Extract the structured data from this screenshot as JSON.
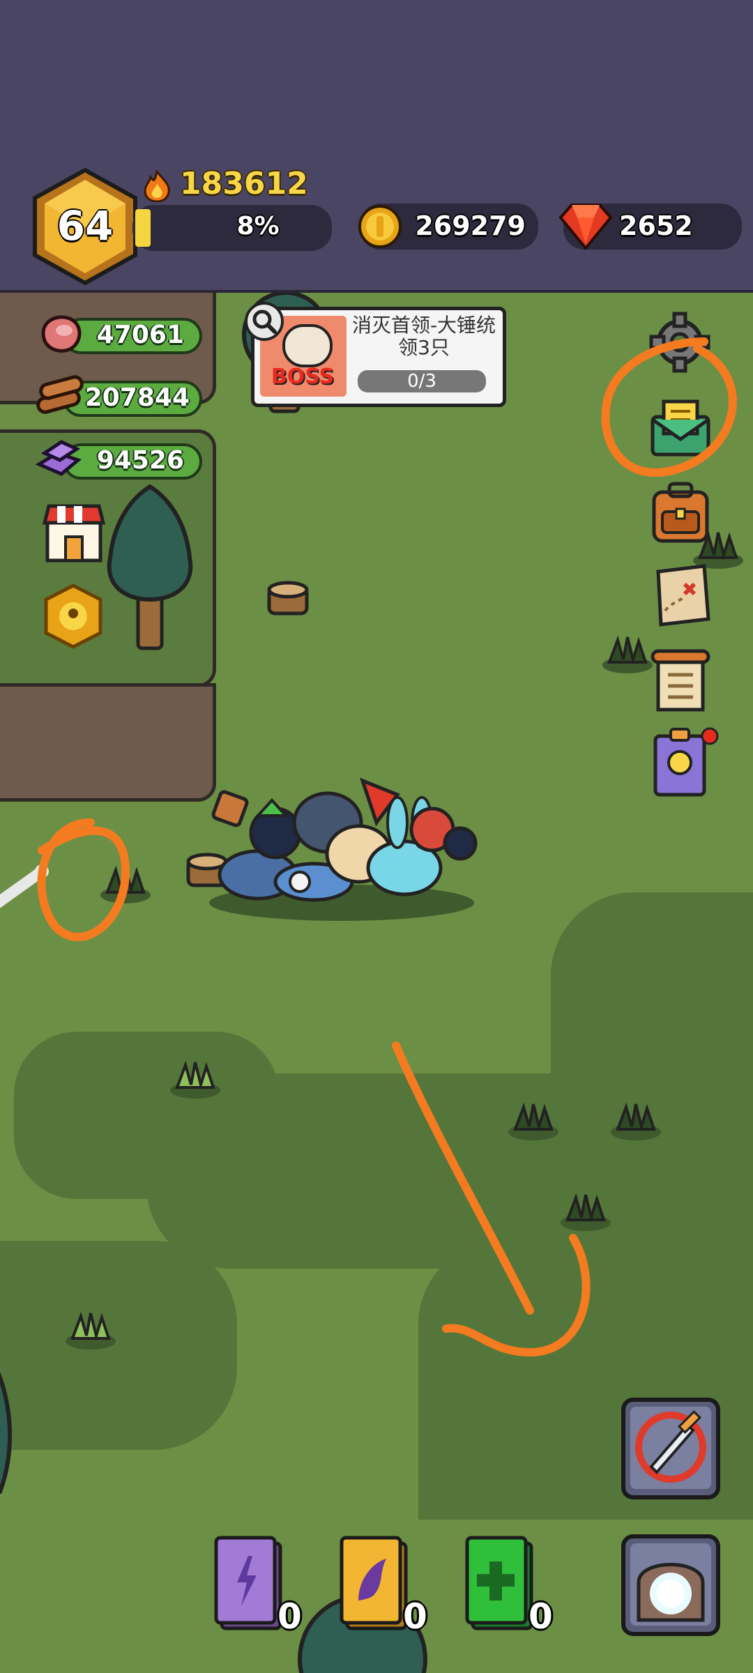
{
  "header": {
    "level": "64",
    "power": "183612",
    "exp_percent": "8%",
    "exp_progress": 0.08,
    "coins": "269279",
    "gems": "2652"
  },
  "resources": {
    "meat": "47061",
    "wood": "207844",
    "ore": "94526"
  },
  "quest": {
    "badge": "BOSS",
    "title": "消灭首领-大锤统领3只",
    "progress": "0/3"
  },
  "books": [
    {
      "color": "purple",
      "count": "0"
    },
    {
      "color": "gold",
      "count": "0"
    },
    {
      "color": "green",
      "count": "0"
    }
  ],
  "colors": {
    "header_bg": "#4a4563",
    "grass": "#6c8f46",
    "grass_dark": "#55763a",
    "annotation": "#f47b20"
  },
  "icons": {
    "power": "flame-icon",
    "coin": "coin-icon",
    "gem": "gem-icon",
    "meat": "meat-icon",
    "wood": "wood-icon",
    "ore": "ore-icon"
  }
}
